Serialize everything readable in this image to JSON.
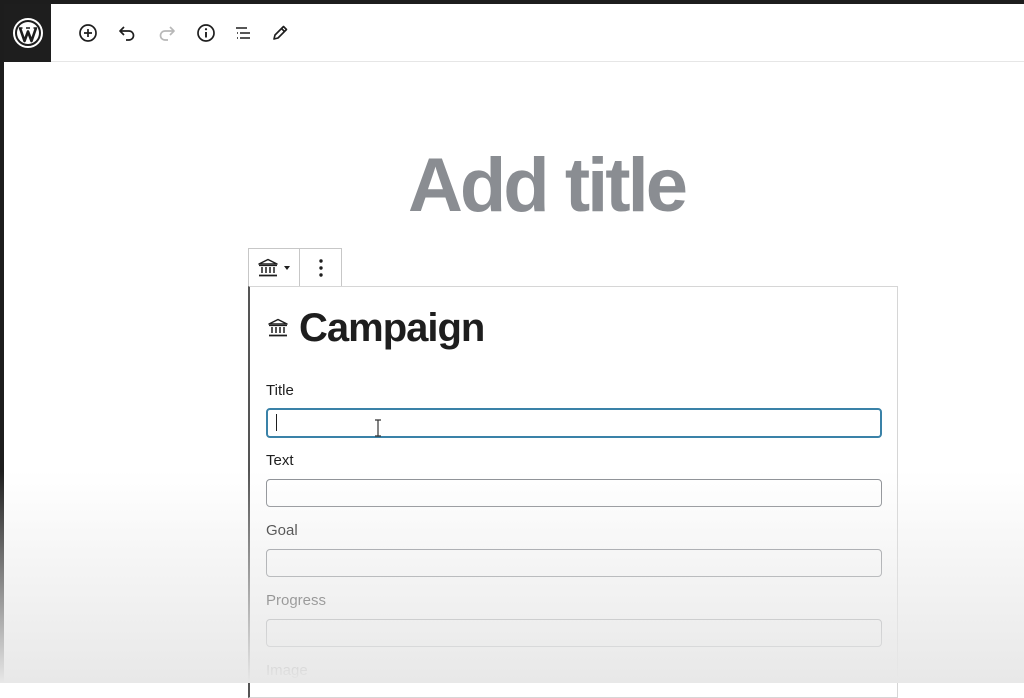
{
  "toolbar": {
    "logo_icon": "wordpress-logo-icon",
    "buttons": [
      {
        "name": "add-block-button",
        "icon": "plus-circle-icon"
      },
      {
        "name": "undo-button",
        "icon": "undo-icon"
      },
      {
        "name": "redo-button",
        "icon": "redo-icon"
      },
      {
        "name": "details-button",
        "icon": "info-icon"
      },
      {
        "name": "list-view-button",
        "icon": "list-view-icon"
      },
      {
        "name": "tools-button",
        "icon": "pencil-icon"
      }
    ]
  },
  "editor": {
    "title_placeholder": "Add title"
  },
  "block": {
    "icon": "bank-icon",
    "heading": "Campaign",
    "fields": [
      {
        "label": "Title",
        "value": "",
        "focused": true
      },
      {
        "label": "Text",
        "value": ""
      },
      {
        "label": "Goal",
        "value": ""
      },
      {
        "label": "Progress",
        "value": ""
      },
      {
        "label": "Image"
      }
    ]
  },
  "colors": {
    "accent": "#3a82a8",
    "title_placeholder": "#8a8d92",
    "logo_bg": "#1e1e1e"
  }
}
